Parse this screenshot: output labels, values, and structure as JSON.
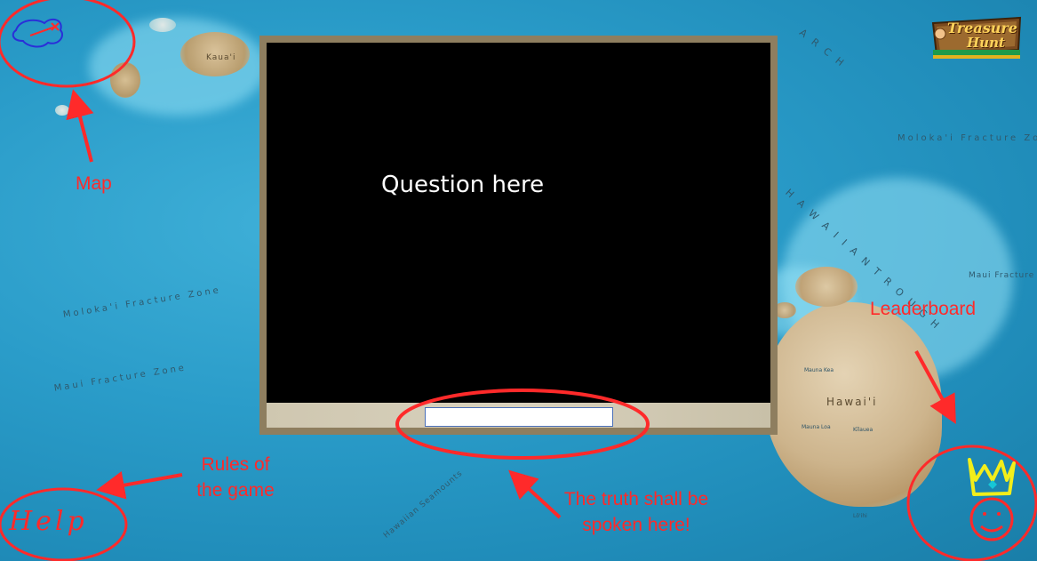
{
  "question": {
    "text": "Question here"
  },
  "answer": {
    "value": "",
    "placeholder": ""
  },
  "annotations": {
    "map": "Map",
    "rules_line1": "Rules of",
    "rules_line2": "the game",
    "truth_line1": "The truth shall be",
    "truth_line2": "spoken here!",
    "leaderboard": "Leaderboard"
  },
  "help_button": {
    "label": "Help"
  },
  "logo": {
    "line1": "Treasure",
    "line2": "Hunt"
  },
  "map_labels": {
    "kauai": "Kaua'i",
    "hawaii": "Hawai'i",
    "molokai_fz_left": "Moloka'i  Fracture  Zone",
    "maui_fz_left": "Maui  Fracture  Zone",
    "molokai_fz_right": "Moloka'i  Fracture  Zone",
    "maui_fz_right": "Maui Fracture Zone",
    "trough": "H A W A I I A N   T R O U G H",
    "arch": "A R C H",
    "seamounts": "Hawaiian Seamounts",
    "mauna_kea": "Mauna Kea",
    "mauna_loa": "Mauna Loa",
    "kilauea": "Kīlauea",
    "loihi": "Lō'ihi"
  },
  "colors": {
    "annotation": "#ff2a2a",
    "panel_frame": "#8e7e5f",
    "screen": "#000000",
    "crown": "#f2ee1a"
  }
}
